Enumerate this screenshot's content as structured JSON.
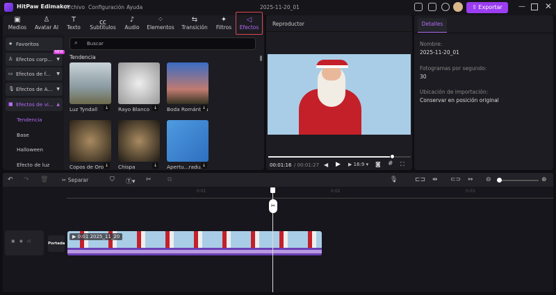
{
  "app": {
    "name": "HitPaw Edimakor",
    "menu": [
      "Archivo",
      "Configuración",
      "Ayuda"
    ],
    "project_title": "2025-11-20_01",
    "export_label": "Exportar",
    "accent": "#9b3df0"
  },
  "toolbar": {
    "tabs": [
      {
        "label": "Medios",
        "icon": "media-icon"
      },
      {
        "label": "Avatar AI",
        "icon": "avatar-icon"
      },
      {
        "label": "Texto",
        "icon": "text-icon"
      },
      {
        "label": "Subtítulos",
        "icon": "subtitles-icon"
      },
      {
        "label": "Audio",
        "icon": "music-icon"
      },
      {
        "label": "Elementos",
        "icon": "elements-icon"
      },
      {
        "label": "Transición",
        "icon": "transition-icon"
      },
      {
        "label": "Filtros",
        "icon": "filters-icon"
      },
      {
        "label": "Efectos",
        "icon": "effects-icon",
        "active": true
      }
    ]
  },
  "sidebar": {
    "items": [
      {
        "label": "Favoritos"
      },
      {
        "label": "Efectos corp...",
        "badge": "NEW"
      },
      {
        "label": "Efectos de f..."
      },
      {
        "label": "Efectos de A..."
      },
      {
        "label": "Efectos de vi..."
      }
    ],
    "subitems": [
      "Tendencia",
      "Base",
      "Halloween",
      "Efecto de luz"
    ]
  },
  "effects": {
    "search_placeholder": "Buscar",
    "section": "Tendencia",
    "items": [
      {
        "label": "Luz Tyndall"
      },
      {
        "label": "Rayo Blanco"
      },
      {
        "label": "Boda Romántica"
      },
      {
        "label": "Copos de Oro"
      },
      {
        "label": "Chispa"
      },
      {
        "label": "Apertu...radual"
      }
    ]
  },
  "player": {
    "title": "Reproductor",
    "current_time": "00:01:16",
    "total_time": "/ 00:01:27",
    "aspect": "16:9",
    "progress": 0.87
  },
  "details": {
    "tab": "Detalles",
    "name_label": "Nombre:",
    "name_value": "2025-11-20_01",
    "fps_label": "Fotogramas por segundo:",
    "fps_value": "30",
    "import_label": "Ubicación de importación:",
    "import_value": "Conservar en posición original"
  },
  "timeline": {
    "split_label": "Separar",
    "ruler": [
      "0:01",
      "0:02",
      "0:03"
    ],
    "cover_label": "Portada",
    "clip_label": "0:01 2025_11_20"
  }
}
